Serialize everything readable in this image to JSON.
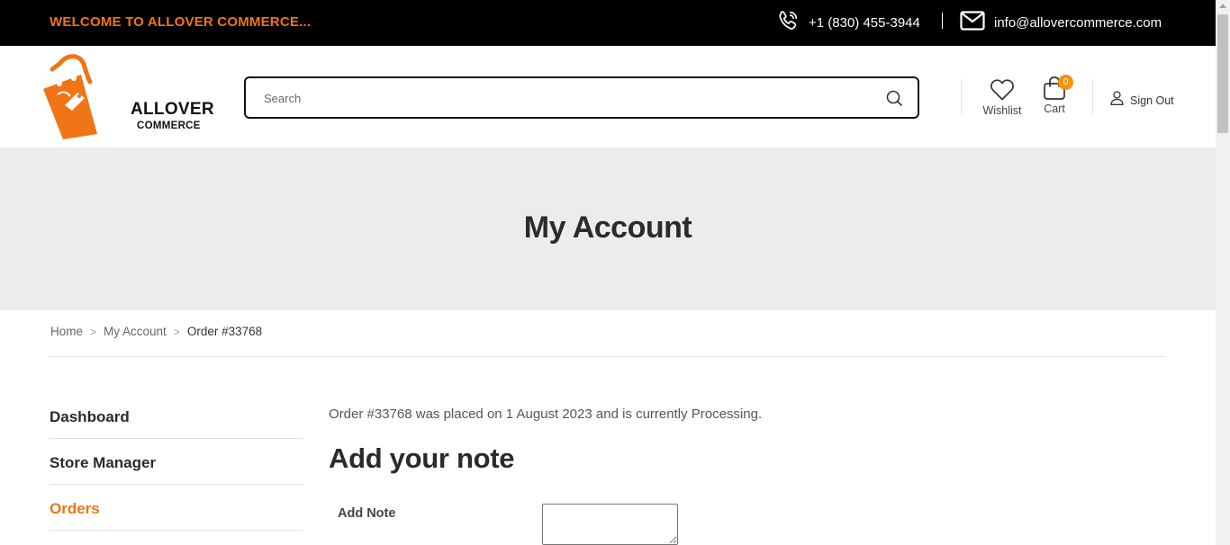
{
  "topbar": {
    "welcome": "WELCOME TO ALLOVER COMMERCE...",
    "phone": "+1 (830) 455-3944",
    "email": "info@allovercommerce.com",
    "phone_icon": "phone-icon",
    "email_icon": "envelope-icon"
  },
  "header": {
    "logo": {
      "line1": "ALLOVER",
      "line2": "COMMERCE"
    },
    "search": {
      "placeholder": "Search",
      "value": ""
    },
    "wishlist_label": "Wishlist",
    "cart_label": "Cart",
    "cart_count": "0",
    "signout_label": "Sign Out"
  },
  "banner": {
    "title": "My Account"
  },
  "breadcrumb": {
    "items": [
      "Home",
      "My Account"
    ],
    "current": "Order #33768",
    "separator": ">"
  },
  "sidebar": {
    "items": [
      {
        "label": "Dashboard",
        "active": false
      },
      {
        "label": "Store Manager",
        "active": false
      },
      {
        "label": "Orders",
        "active": true
      }
    ]
  },
  "main": {
    "order_status": "Order #33768 was placed on 1 August 2023 and is currently Processing.",
    "note_title": "Add your note",
    "note_label": "Add Note",
    "note_value": ""
  },
  "colors": {
    "accent": "#f07516",
    "topbar_bg": "#000000",
    "banner_bg": "#ececec",
    "badge": "#f5920f"
  }
}
